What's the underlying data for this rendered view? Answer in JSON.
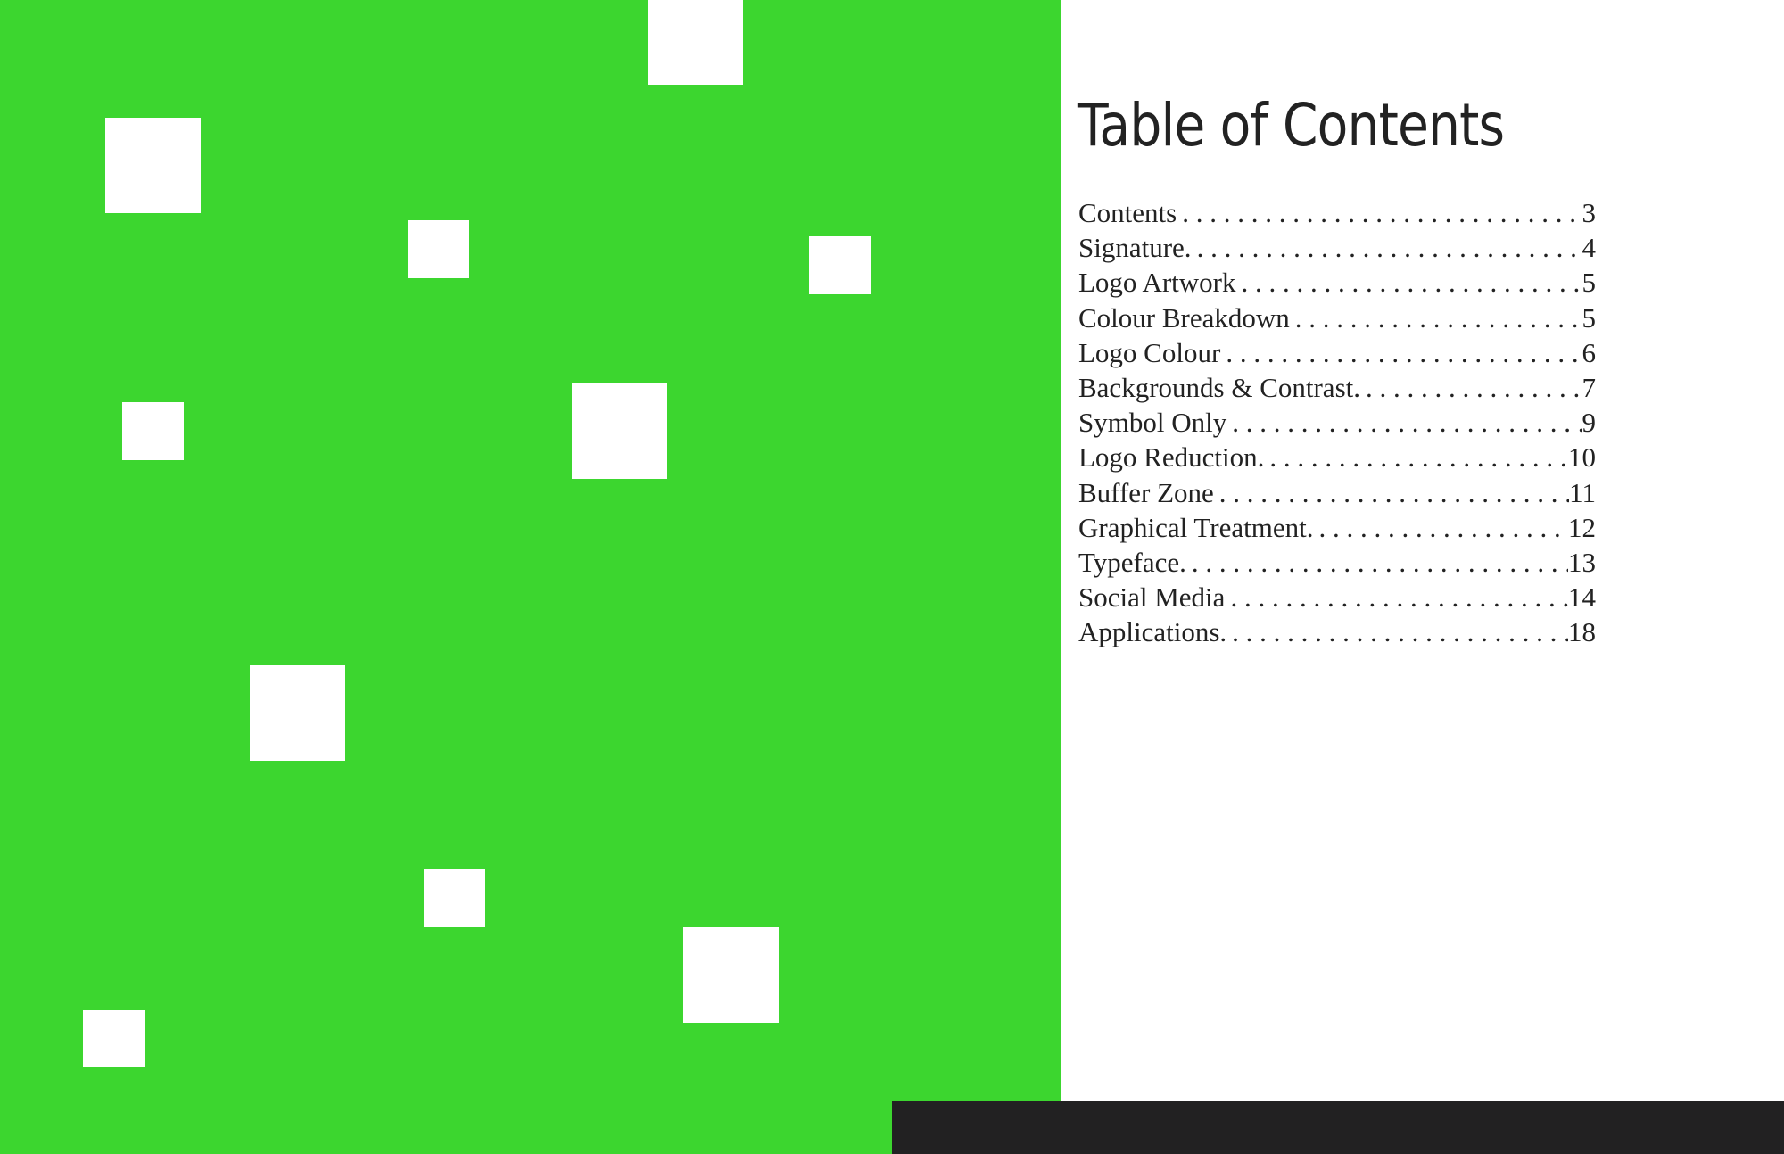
{
  "colors": {
    "accent_green": "#3cd62f",
    "dark_bar": "#222122",
    "text": "#222222",
    "background": "#ffffff"
  },
  "toc": {
    "title": "Table of Contents",
    "items": [
      {
        "label": "Contents",
        "page": "3"
      },
      {
        "label": "Signature.",
        "page": "4"
      },
      {
        "label": "Logo Artwork",
        "page": "5"
      },
      {
        "label": "Colour Breakdown",
        "page": "5"
      },
      {
        "label": "Logo Colour",
        "page": "6"
      },
      {
        "label": "Backgrounds & Contrast.",
        "page": "7"
      },
      {
        "label": "Symbol Only",
        "page": "9"
      },
      {
        "label": "Logo Reduction.",
        "page": "10"
      },
      {
        "label": "Buffer Zone",
        "page": "11"
      },
      {
        "label": "Graphical Treatment.",
        "page": "12"
      },
      {
        "label": "Typeface.",
        "page": "13"
      },
      {
        "label": "Social Media",
        "page": "14"
      },
      {
        "label": "Applications.",
        "page": "18"
      }
    ]
  }
}
